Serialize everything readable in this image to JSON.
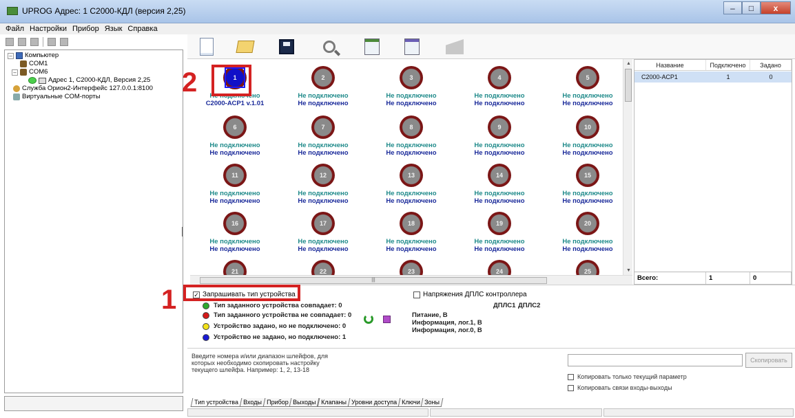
{
  "window": {
    "title": "UPROG Адрес:  1  С2000-КДЛ (версия  2,25)",
    "controls": [
      "–",
      "□",
      "x"
    ]
  },
  "menu": [
    "Файл",
    "Настройки",
    "Прибор",
    "Язык",
    "Справка"
  ],
  "tree": {
    "items": [
      {
        "label": "Компьютер",
        "expander": "–",
        "icon": "computer-icon"
      },
      {
        "label": "COM1",
        "icon": "port-icon"
      },
      {
        "label": "COM6",
        "expander": "–",
        "icon": "port-icon"
      },
      {
        "label": "Адрес 1, С2000-КДЛ, Версия 2,25",
        "icon": "device-icon"
      },
      {
        "label": "Служба Орион2-Интерфейс 127.0.0.1:8100",
        "icon": "service-icon"
      },
      {
        "label": "Виртуальные COM-порты",
        "icon": "virtual-port-icon"
      }
    ]
  },
  "devices": {
    "not_connected": "Не подключено",
    "grid": [
      {
        "n": "1",
        "line1": "Не подключено",
        "line2": "С2000-АСР1  v.1.01",
        "active": true
      },
      {
        "n": "2",
        "line1": "Не подключено",
        "line2": "Не подключено"
      },
      {
        "n": "3",
        "line1": "Не подключено",
        "line2": "Не подключено"
      },
      {
        "n": "4",
        "line1": "Не подключено",
        "line2": "Не подключено"
      },
      {
        "n": "5",
        "line1": "Не подключено",
        "line2": "Не подключено"
      },
      {
        "n": "6",
        "line1": "Не подключено",
        "line2": "Не подключено"
      },
      {
        "n": "7",
        "line1": "Не подключено",
        "line2": "Не подключено"
      },
      {
        "n": "8",
        "line1": "Не подключено",
        "line2": "Не подключено"
      },
      {
        "n": "9",
        "line1": "Не подключено",
        "line2": "Не подключено"
      },
      {
        "n": "10",
        "line1": "Не подключено",
        "line2": "Не подключено"
      },
      {
        "n": "11",
        "line1": "Не подключено",
        "line2": "Не подключено"
      },
      {
        "n": "12",
        "line1": "Не подключено",
        "line2": "Не подключено"
      },
      {
        "n": "13",
        "line1": "Не подключено",
        "line2": "Не подключено"
      },
      {
        "n": "14",
        "line1": "Не подключено",
        "line2": "Не подключено"
      },
      {
        "n": "15",
        "line1": "Не подключено",
        "line2": "Не подключено"
      },
      {
        "n": "16",
        "line1": "Не подключено",
        "line2": "Не подключено"
      },
      {
        "n": "17",
        "line1": "Не подключено",
        "line2": "Не подключено"
      },
      {
        "n": "18",
        "line1": "Не подключено",
        "line2": "Не подключено"
      },
      {
        "n": "19",
        "line1": "Не подключено",
        "line2": "Не подключено"
      },
      {
        "n": "20",
        "line1": "Не подключено",
        "line2": "Не подключено"
      },
      {
        "n": "21"
      },
      {
        "n": "22"
      },
      {
        "n": "23"
      },
      {
        "n": "24"
      },
      {
        "n": "25"
      }
    ]
  },
  "side_table": {
    "headers": [
      "Название",
      "Подключено",
      "Задано"
    ],
    "rows": [
      [
        "С2000-АСР1",
        "1",
        "0"
      ]
    ],
    "footer": [
      "Всего:",
      "1",
      "0"
    ]
  },
  "annotations": {
    "one": "1",
    "two": "2"
  },
  "status": {
    "query_type_label": "Запрашивать тип устройства",
    "query_type_checked": true,
    "legend": [
      {
        "text": "Тип заданного устройства совпадает:  0",
        "color": "#2ea82e"
      },
      {
        "text": "Тип заданного устройства не совпадает: 0",
        "color": "#d41a1a"
      },
      {
        "text": "Устройство задано, но не подключено: 0",
        "color": "#f2e21a"
      },
      {
        "text": "Устройство не задано, но подключено: 1",
        "color": "#1a1ad4"
      }
    ],
    "voltage_label": "Напряжения ДПЛС контроллера",
    "dpls1": "ДПЛС1",
    "dpls2": "ДПЛС2",
    "voltage_rows": [
      "Питание, В",
      "Информация, лог.1, В",
      "Информация, лог.0, В"
    ]
  },
  "copy": {
    "description": "Введите номера и/или диапазон шлейфов, для которых необходимо скопировать настройку текущего шлейфа. Например: 1, 2, 13-18",
    "button": "Скопировать",
    "only_current": "Копировать только текущий параметр",
    "copy_links": "Копировать связи входы-выходы"
  },
  "tabs": [
    "Тип устройства",
    "Входы",
    "Прибор",
    "Выходы",
    "Клапаны",
    "Уровни доступа",
    "Ключи",
    "Зоны"
  ]
}
